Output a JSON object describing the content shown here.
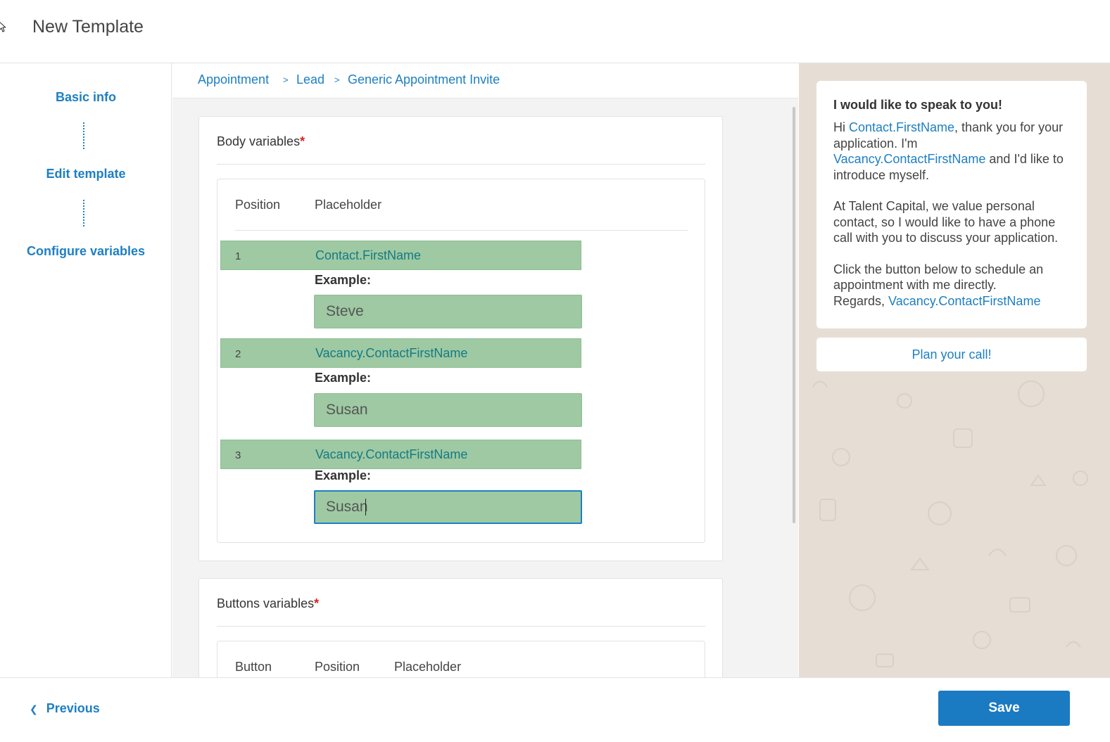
{
  "header": {
    "title": "New Template"
  },
  "sidebar": {
    "steps": [
      {
        "label": "Basic info"
      },
      {
        "label": "Edit template"
      },
      {
        "label": "Configure variables"
      }
    ]
  },
  "breadcrumb": {
    "items": [
      {
        "label": "Appointment"
      },
      {
        "label": "Lead"
      },
      {
        "label": "Generic Appointment Invite"
      }
    ],
    "separator": ">"
  },
  "body_variables": {
    "title": "Body variables",
    "required_mark": "*",
    "columns": {
      "position": "Position",
      "placeholder": "Placeholder"
    },
    "example_label": "Example:",
    "rows": [
      {
        "position": "1",
        "placeholder": "Contact.FirstName",
        "example": "Steve"
      },
      {
        "position": "2",
        "placeholder": "Vacancy.ContactFirstName",
        "example": "Susan"
      },
      {
        "position": "3",
        "placeholder": "Vacancy.ContactFirstName",
        "example": "Susan"
      }
    ]
  },
  "buttons_variables": {
    "title": "Buttons variables",
    "required_mark": "*",
    "columns": {
      "button": "Button",
      "position": "Position",
      "placeholder": "Placeholder"
    }
  },
  "preview": {
    "title": "I would like to speak to you!",
    "p1_a": "Hi ",
    "p1_var1": "Contact.FirstName",
    "p1_b": ", thank you for your application. I'm ",
    "p1_var2": "Vacancy.ContactFirstName",
    "p1_c": " and I'd like to introduce myself.",
    "p2": "At Talent Capital, we value personal contact, so I would like to have a phone call with you to discuss your application.",
    "p3_a": "Click the button below to schedule an appointment with me directly.",
    "p3_b": "Regards, ",
    "p3_var": "Vacancy.ContactFirstName",
    "button": "Plan your call!"
  },
  "footer": {
    "previous": "Previous",
    "save": "Save"
  },
  "colors": {
    "accent": "#1d7fc4",
    "highlight": "#9ec9a2",
    "required": "#e02020",
    "chat_bg": "#e6ded5"
  },
  "icons": {
    "previous": "chevron-left-icon",
    "cursor": "mouse-pointer-icon"
  }
}
